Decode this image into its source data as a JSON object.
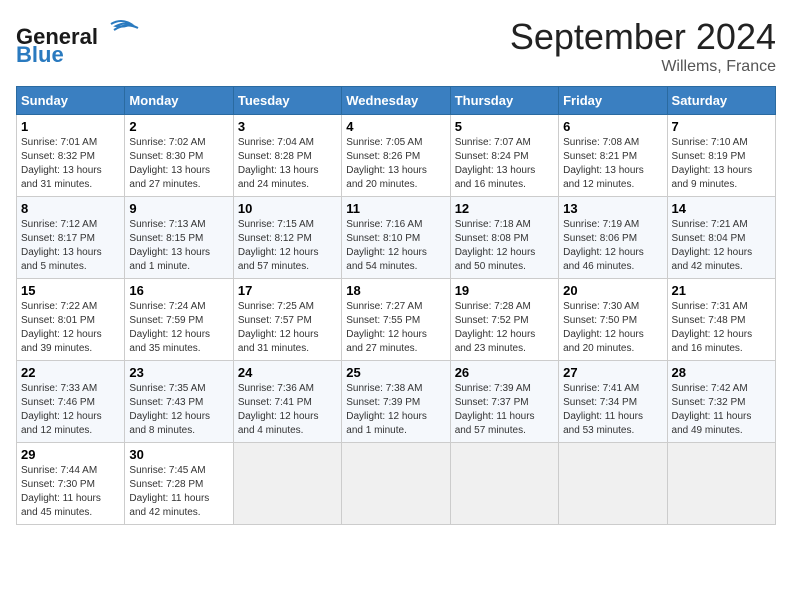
{
  "header": {
    "logo_general": "General",
    "logo_blue": "Blue",
    "month_title": "September 2024",
    "location": "Willems, France"
  },
  "weekdays": [
    "Sunday",
    "Monday",
    "Tuesday",
    "Wednesday",
    "Thursday",
    "Friday",
    "Saturday"
  ],
  "weeks": [
    [
      {
        "num": "1",
        "info": "Sunrise: 7:01 AM\nSunset: 8:32 PM\nDaylight: 13 hours\nand 31 minutes."
      },
      {
        "num": "2",
        "info": "Sunrise: 7:02 AM\nSunset: 8:30 PM\nDaylight: 13 hours\nand 27 minutes."
      },
      {
        "num": "3",
        "info": "Sunrise: 7:04 AM\nSunset: 8:28 PM\nDaylight: 13 hours\nand 24 minutes."
      },
      {
        "num": "4",
        "info": "Sunrise: 7:05 AM\nSunset: 8:26 PM\nDaylight: 13 hours\nand 20 minutes."
      },
      {
        "num": "5",
        "info": "Sunrise: 7:07 AM\nSunset: 8:24 PM\nDaylight: 13 hours\nand 16 minutes."
      },
      {
        "num": "6",
        "info": "Sunrise: 7:08 AM\nSunset: 8:21 PM\nDaylight: 13 hours\nand 12 minutes."
      },
      {
        "num": "7",
        "info": "Sunrise: 7:10 AM\nSunset: 8:19 PM\nDaylight: 13 hours\nand 9 minutes."
      }
    ],
    [
      {
        "num": "8",
        "info": "Sunrise: 7:12 AM\nSunset: 8:17 PM\nDaylight: 13 hours\nand 5 minutes."
      },
      {
        "num": "9",
        "info": "Sunrise: 7:13 AM\nSunset: 8:15 PM\nDaylight: 13 hours\nand 1 minute."
      },
      {
        "num": "10",
        "info": "Sunrise: 7:15 AM\nSunset: 8:12 PM\nDaylight: 12 hours\nand 57 minutes."
      },
      {
        "num": "11",
        "info": "Sunrise: 7:16 AM\nSunset: 8:10 PM\nDaylight: 12 hours\nand 54 minutes."
      },
      {
        "num": "12",
        "info": "Sunrise: 7:18 AM\nSunset: 8:08 PM\nDaylight: 12 hours\nand 50 minutes."
      },
      {
        "num": "13",
        "info": "Sunrise: 7:19 AM\nSunset: 8:06 PM\nDaylight: 12 hours\nand 46 minutes."
      },
      {
        "num": "14",
        "info": "Sunrise: 7:21 AM\nSunset: 8:04 PM\nDaylight: 12 hours\nand 42 minutes."
      }
    ],
    [
      {
        "num": "15",
        "info": "Sunrise: 7:22 AM\nSunset: 8:01 PM\nDaylight: 12 hours\nand 39 minutes."
      },
      {
        "num": "16",
        "info": "Sunrise: 7:24 AM\nSunset: 7:59 PM\nDaylight: 12 hours\nand 35 minutes."
      },
      {
        "num": "17",
        "info": "Sunrise: 7:25 AM\nSunset: 7:57 PM\nDaylight: 12 hours\nand 31 minutes."
      },
      {
        "num": "18",
        "info": "Sunrise: 7:27 AM\nSunset: 7:55 PM\nDaylight: 12 hours\nand 27 minutes."
      },
      {
        "num": "19",
        "info": "Sunrise: 7:28 AM\nSunset: 7:52 PM\nDaylight: 12 hours\nand 23 minutes."
      },
      {
        "num": "20",
        "info": "Sunrise: 7:30 AM\nSunset: 7:50 PM\nDaylight: 12 hours\nand 20 minutes."
      },
      {
        "num": "21",
        "info": "Sunrise: 7:31 AM\nSunset: 7:48 PM\nDaylight: 12 hours\nand 16 minutes."
      }
    ],
    [
      {
        "num": "22",
        "info": "Sunrise: 7:33 AM\nSunset: 7:46 PM\nDaylight: 12 hours\nand 12 minutes."
      },
      {
        "num": "23",
        "info": "Sunrise: 7:35 AM\nSunset: 7:43 PM\nDaylight: 12 hours\nand 8 minutes."
      },
      {
        "num": "24",
        "info": "Sunrise: 7:36 AM\nSunset: 7:41 PM\nDaylight: 12 hours\nand 4 minutes."
      },
      {
        "num": "25",
        "info": "Sunrise: 7:38 AM\nSunset: 7:39 PM\nDaylight: 12 hours\nand 1 minute."
      },
      {
        "num": "26",
        "info": "Sunrise: 7:39 AM\nSunset: 7:37 PM\nDaylight: 11 hours\nand 57 minutes."
      },
      {
        "num": "27",
        "info": "Sunrise: 7:41 AM\nSunset: 7:34 PM\nDaylight: 11 hours\nand 53 minutes."
      },
      {
        "num": "28",
        "info": "Sunrise: 7:42 AM\nSunset: 7:32 PM\nDaylight: 11 hours\nand 49 minutes."
      }
    ],
    [
      {
        "num": "29",
        "info": "Sunrise: 7:44 AM\nSunset: 7:30 PM\nDaylight: 11 hours\nand 45 minutes."
      },
      {
        "num": "30",
        "info": "Sunrise: 7:45 AM\nSunset: 7:28 PM\nDaylight: 11 hours\nand 42 minutes."
      },
      {
        "num": "",
        "info": "",
        "empty": true
      },
      {
        "num": "",
        "info": "",
        "empty": true
      },
      {
        "num": "",
        "info": "",
        "empty": true
      },
      {
        "num": "",
        "info": "",
        "empty": true
      },
      {
        "num": "",
        "info": "",
        "empty": true
      }
    ]
  ]
}
